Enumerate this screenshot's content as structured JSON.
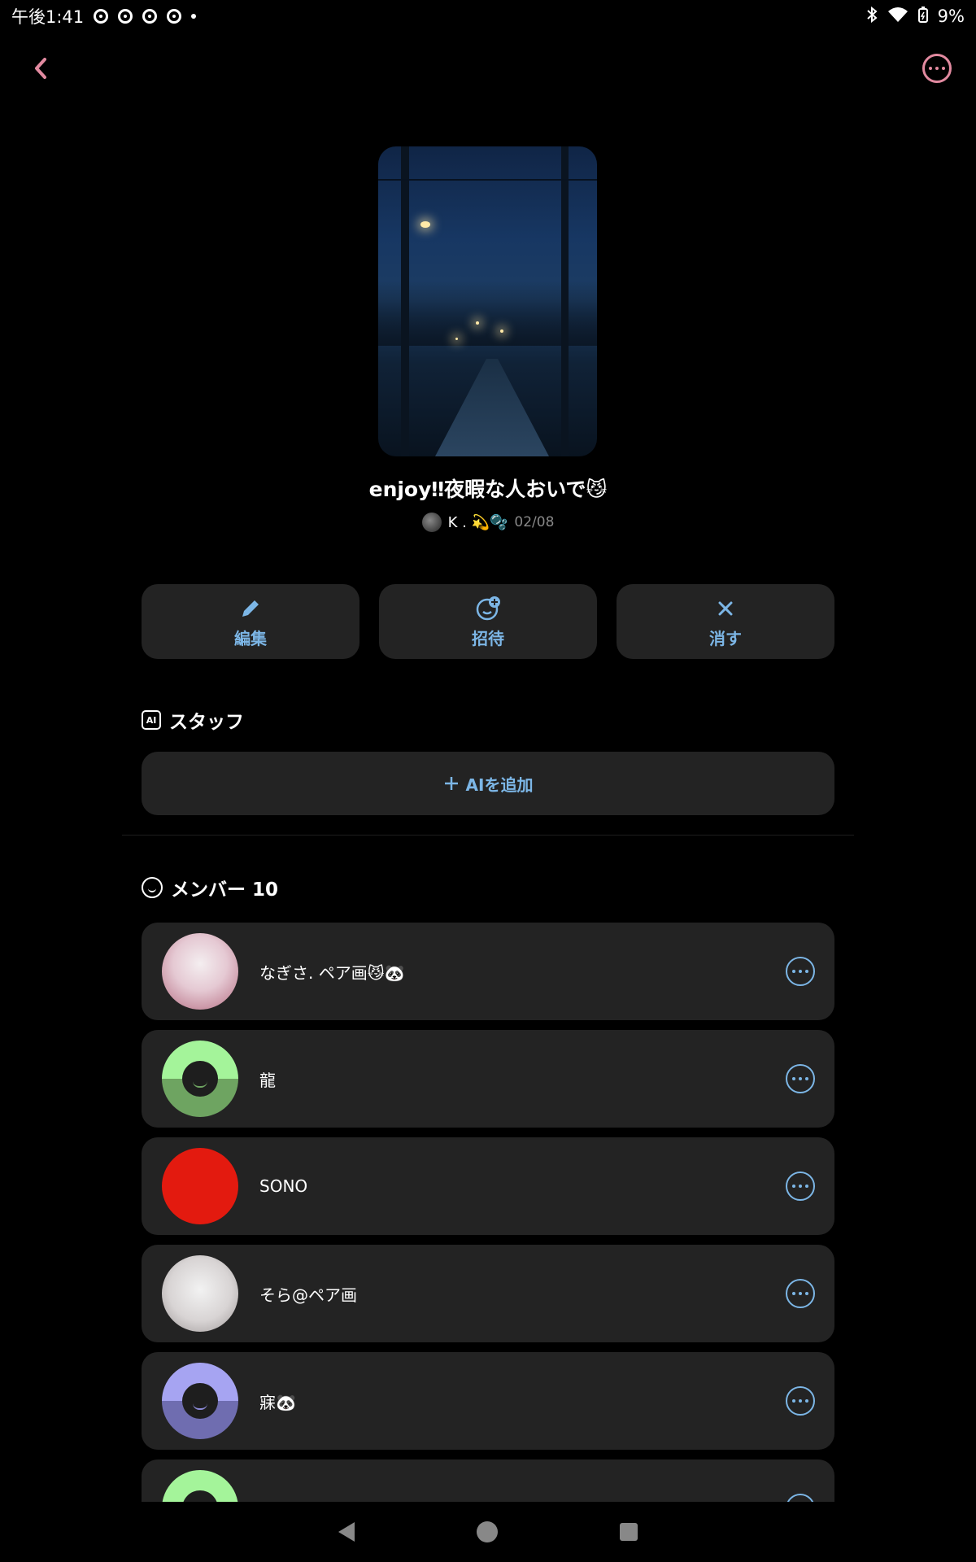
{
  "status_bar": {
    "time": "午後1:41",
    "battery": "9%"
  },
  "room": {
    "title": "enjoy‼夜暇な人おいで😼",
    "owner": "K . 💫🫧",
    "date": "02/08"
  },
  "actions": [
    {
      "label": "編集",
      "icon": "pencil-icon"
    },
    {
      "label": "招待",
      "icon": "invite-icon"
    },
    {
      "label": "消す",
      "icon": "close-icon"
    }
  ],
  "staff": {
    "badge": "AI",
    "title": "スタッフ",
    "add_label": "AIを追加"
  },
  "members": {
    "title": "メンバー 10",
    "items": [
      {
        "name": "なぎさ. ペア画😼🐼",
        "avatar": "image"
      },
      {
        "name": "龍",
        "avatar": "smiley-green"
      },
      {
        "name": "SONO",
        "avatar": "solid-red"
      },
      {
        "name": "そら@ペア画",
        "avatar": "image"
      },
      {
        "name": "寐🐼",
        "avatar": "smiley-purple"
      }
    ]
  },
  "colors": {
    "accent": "#7cb6e6",
    "top_icon": "#e28aa0",
    "card": "#232323"
  }
}
